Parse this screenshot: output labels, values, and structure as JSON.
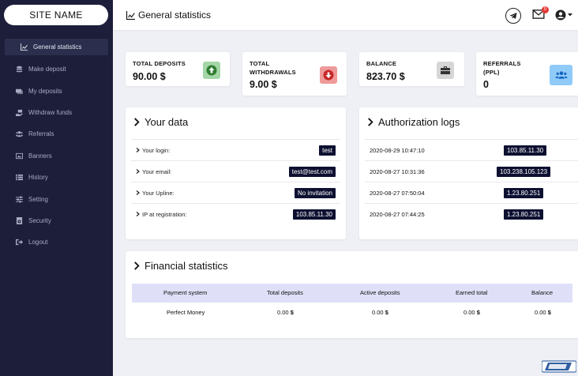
{
  "sidebar": {
    "site_name": "SITE NAME",
    "items": [
      {
        "label": "General statistics",
        "icon": "chart-line-icon"
      },
      {
        "label": "Make deposit",
        "icon": "coins-icon"
      },
      {
        "label": "My deposits",
        "icon": "money-bills-icon"
      },
      {
        "label": "Withdraw funds",
        "icon": "hand-money-icon"
      },
      {
        "label": "Referrals",
        "icon": "users-icon"
      },
      {
        "label": "Banners",
        "icon": "image-icon"
      },
      {
        "label": "History",
        "icon": "list-icon"
      },
      {
        "label": "Setting",
        "icon": "sliders-icon"
      },
      {
        "label": "Security",
        "icon": "lock-icon"
      },
      {
        "label": "Logout",
        "icon": "sign-out-icon"
      }
    ]
  },
  "header": {
    "title": "General statistics",
    "notification_count": "0"
  },
  "stats": [
    {
      "label_lines": [
        "TOTAL DEPOSITS"
      ],
      "value": "90.00 $",
      "icon": "arrow-up-circle-icon",
      "icon_bg": "#4caf50"
    },
    {
      "label_lines": [
        "TOTAL",
        "WITHDRAWALS"
      ],
      "value": "9.00 $",
      "icon": "arrow-down-circle-icon",
      "icon_bg": "#e53935"
    },
    {
      "label_lines": [
        "BALANCE"
      ],
      "value": "823.70 $",
      "icon": "briefcase-icon",
      "icon_bg": "#555555"
    },
    {
      "label_lines": [
        "REFERRALS",
        "(PPL)"
      ],
      "value": "0",
      "icon": "users-icon",
      "icon_bg": "#2196f3"
    }
  ],
  "your_data": {
    "title": "Your data",
    "rows": [
      {
        "label": "Your login:",
        "value": "test"
      },
      {
        "label": "Your email:",
        "value": "test@test.com"
      },
      {
        "label": "Your Upline:",
        "value": "No invitation"
      },
      {
        "label": "IP at registration:",
        "value": "103.85.11.30"
      }
    ]
  },
  "auth_logs": {
    "title": "Authorization logs",
    "rows": [
      {
        "time": "2020-08-29 10:47:10",
        "ip": "103.85.11.30"
      },
      {
        "time": "2020-08-27 10:31:36",
        "ip": "103.238.105.123"
      },
      {
        "time": "2020-08-27 07:50:04",
        "ip": "1.23.80.251"
      },
      {
        "time": "2020-08-27 07:44:25",
        "ip": "1.23.80.251"
      }
    ]
  },
  "financial": {
    "title": "Financial statistics",
    "columns": [
      "Payment system",
      "Total deposits",
      "Active deposits",
      "Earned total",
      "Balance"
    ],
    "rows": [
      {
        "system": "Perfect Money",
        "total_deposits": "0.00",
        "active_deposits": "0.00",
        "earned_total": "0.00",
        "balance": "0.00",
        "currency": "$"
      }
    ]
  },
  "colors": {
    "sidebar_bg": "#1c1e3a",
    "tag_bg": "#0d1031",
    "table_head_bg": "#dfe0f8"
  }
}
